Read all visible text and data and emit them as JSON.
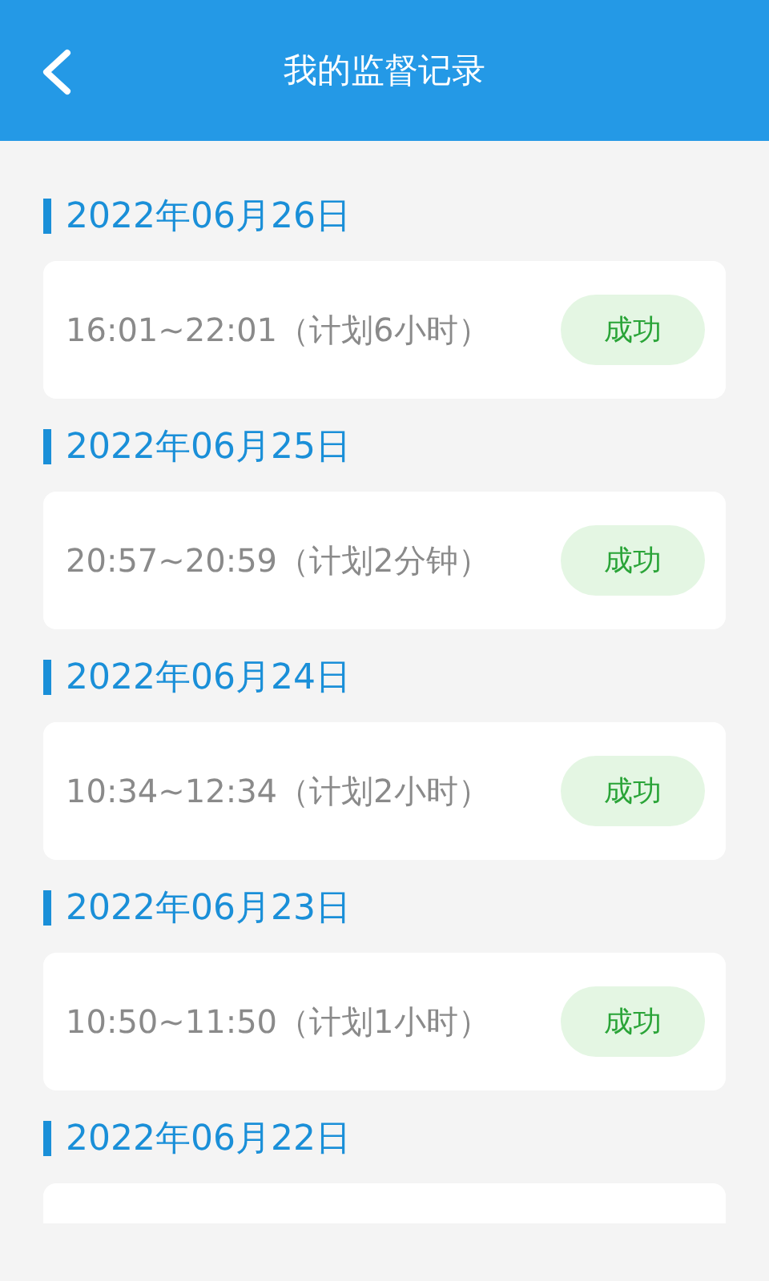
{
  "header": {
    "title": "我的监督记录"
  },
  "records": [
    {
      "date": "2022年06月26日",
      "time": "16:01~22:01（计划6小时）",
      "status": "成功"
    },
    {
      "date": "2022年06月25日",
      "time": "20:57~20:59（计划2分钟）",
      "status": "成功"
    },
    {
      "date": "2022年06月24日",
      "time": "10:34~12:34（计划2小时）",
      "status": "成功"
    },
    {
      "date": "2022年06月23日",
      "time": "10:50~11:50（计划1小时）",
      "status": "成功"
    },
    {
      "date": "2022年06月22日"
    }
  ]
}
